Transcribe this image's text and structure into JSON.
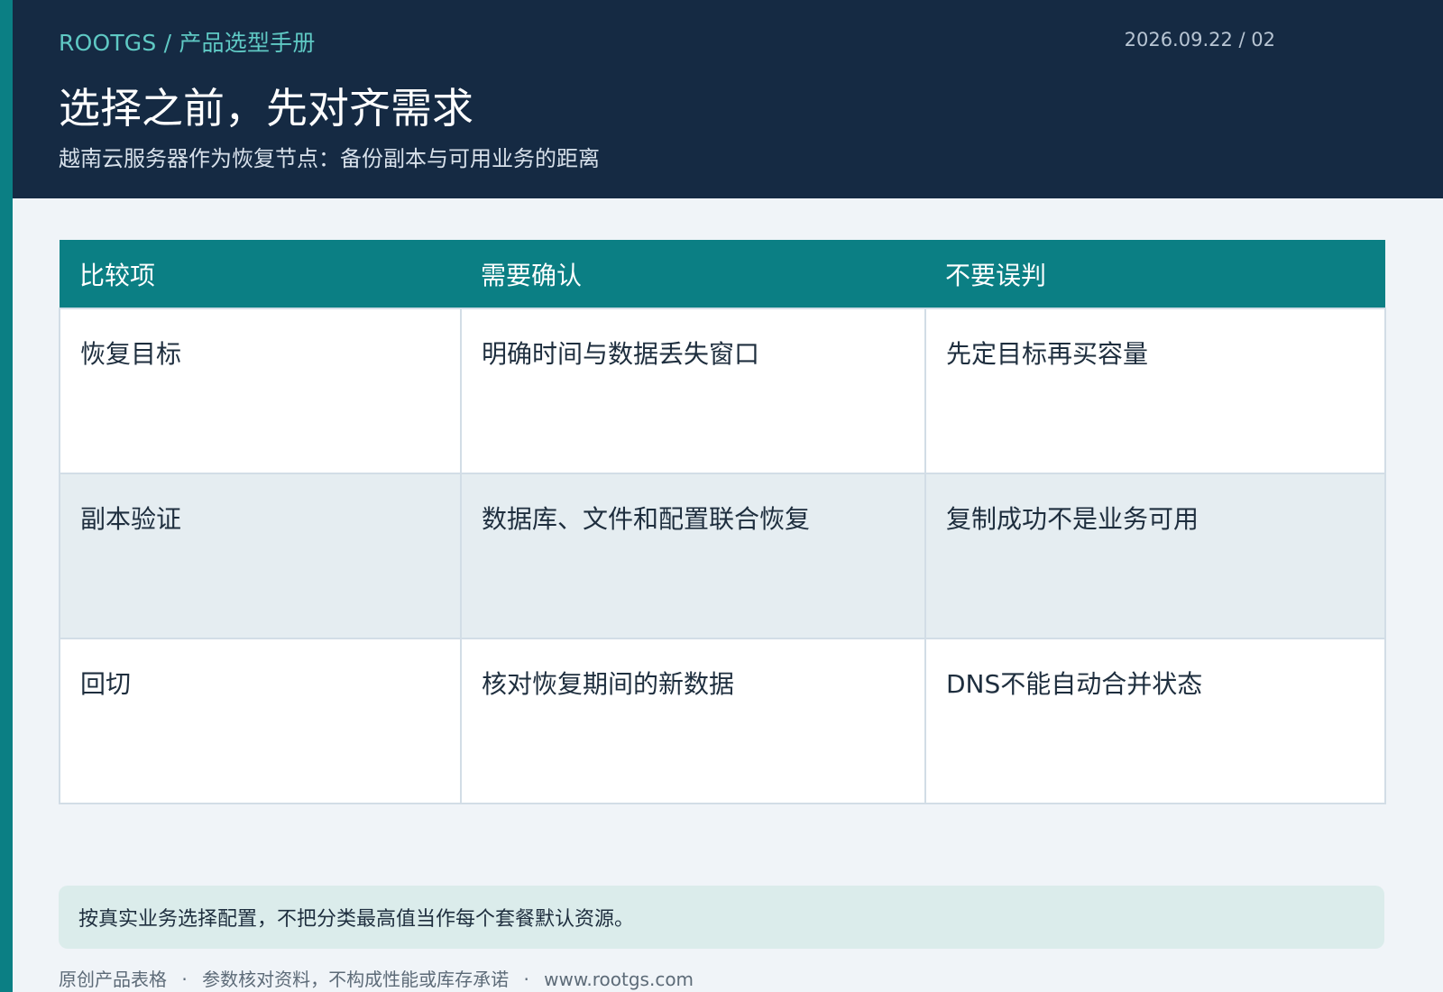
{
  "header": {
    "breadcrumb": "ROOTGS / 产品选型手册",
    "meta": "2026.09.22 / 02",
    "title": "选择之前，先对齐需求",
    "subtitle": "越南云服务器作为恢复节点：备份副本与可用业务的距离"
  },
  "table": {
    "headers": [
      "比较项",
      "需要确认",
      "不要误判"
    ],
    "rows": [
      [
        "恢复目标",
        "明确时间与数据丢失窗口",
        "先定目标再买容量"
      ],
      [
        "副本验证",
        "数据库、文件和配置联合恢复",
        "复制成功不是业务可用"
      ],
      [
        "回切",
        "核对恢复期间的新数据",
        "DNS不能自动合并状态"
      ]
    ]
  },
  "note": "按真实业务选择配置，不把分类最高值当作每个套餐默认资源。",
  "footer": {
    "items": [
      "原创产品表格",
      "参数核对资料，不构成性能或库存承诺",
      "www.rootgs.com"
    ],
    "separator": "·"
  },
  "colors": {
    "header_bg": "#152a43",
    "accent": "#0b7f84",
    "breadcrumb": "#5fc9c4",
    "page_bg": "#f0f4f8",
    "note_bg": "#dbeceb"
  }
}
